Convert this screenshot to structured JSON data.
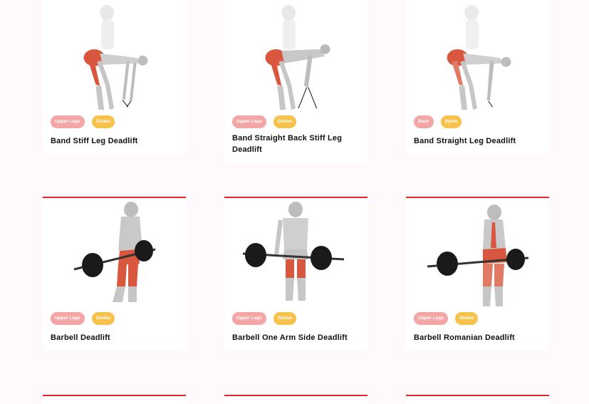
{
  "colors": {
    "accent": "#e3262b",
    "tag_pink": "#f4a6a6",
    "tag_yellow": "#f7c24c",
    "background": "#fff9fb"
  },
  "cards": [
    {
      "title": "Band Stiff Leg Deadlift",
      "tags": [
        "Upper Legs",
        "Glutes"
      ],
      "image_icon": "band-stiff-leg-deadlift-figure"
    },
    {
      "title": "Band Straight Back Stiff Leg Deadlift",
      "tags": [
        "Upper Legs",
        "Glutes"
      ],
      "image_icon": "band-straight-back-stiff-leg-deadlift-figure"
    },
    {
      "title": "Band Straight Leg Deadlift",
      "tags": [
        "Back",
        "Spine"
      ],
      "image_icon": "band-straight-leg-deadlift-figure"
    },
    {
      "title": "Barbell Deadlift",
      "tags": [
        "Upper Legs",
        "Glutes"
      ],
      "image_icon": "barbell-deadlift-figure"
    },
    {
      "title": "Barbell One Arm Side Deadlift",
      "tags": [
        "Upper Legs",
        "Glutes"
      ],
      "image_icon": "barbell-one-arm-side-deadlift-figure"
    },
    {
      "title": "Barbell Romanian Deadlift",
      "tags": [
        "Upper Legs",
        "Glutes"
      ],
      "image_icon": "barbell-romanian-deadlift-figure"
    }
  ]
}
